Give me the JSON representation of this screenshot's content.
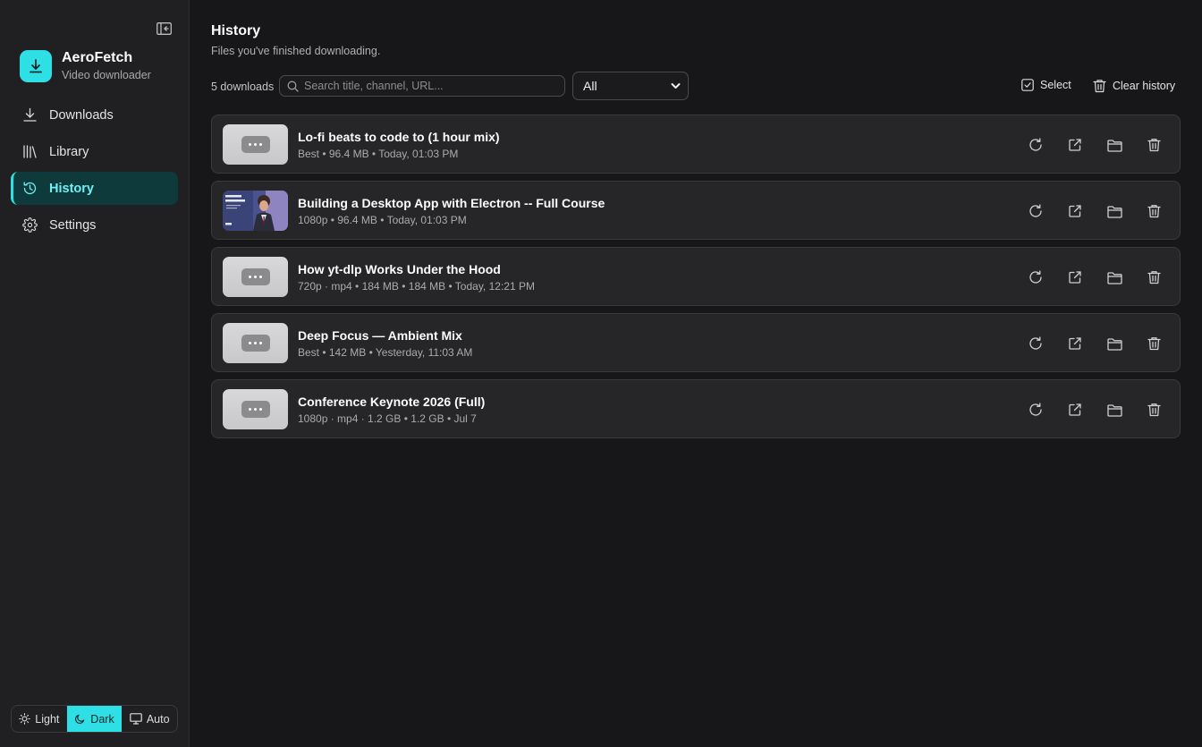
{
  "app": {
    "name": "AeroFetch",
    "subtitle": "Video downloader"
  },
  "sidebar": {
    "items": [
      {
        "label": "Downloads",
        "icon": "download-icon",
        "active": false
      },
      {
        "label": "Library",
        "icon": "library-icon",
        "active": false
      },
      {
        "label": "History",
        "icon": "history-icon",
        "active": true
      },
      {
        "label": "Settings",
        "icon": "gear-icon",
        "active": false
      }
    ]
  },
  "theme": {
    "options": [
      "Light",
      "Dark",
      "Auto"
    ],
    "selected": "Dark"
  },
  "page": {
    "title": "History",
    "subtitle": "Files you've finished downloading."
  },
  "toolbar": {
    "count": "5 downloads",
    "search_placeholder": "Search title, channel, URL...",
    "filter_value": "All",
    "select_label": "Select",
    "clear_label": "Clear history"
  },
  "history": [
    {
      "title": "Lo-fi beats to code to (1 hour mix)",
      "meta": "Best • 96.4 MB • Today, 01:03 PM",
      "thumb": "placeholder"
    },
    {
      "title": "Building a Desktop App with Electron -- Full Course",
      "meta": "1080p • 96.4 MB • Today, 01:03 PM",
      "thumb": "image"
    },
    {
      "title": "How yt-dlp Works Under the Hood",
      "meta": "720p · mp4 • 184 MB • 184 MB • Today, 12:21 PM",
      "thumb": "placeholder"
    },
    {
      "title": "Deep Focus — Ambient Mix",
      "meta": "Best • 142 MB • Yesterday, 11:03 AM",
      "thumb": "placeholder"
    },
    {
      "title": "Conference Keynote 2026 (Full)",
      "meta": "1080p · mp4 · 1.2 GB • 1.2 GB • Jul 7",
      "thumb": "placeholder"
    }
  ],
  "colors": {
    "accent": "#2ee0e6",
    "background": "#171719",
    "sidebar": "#202022",
    "card": "#262628"
  }
}
